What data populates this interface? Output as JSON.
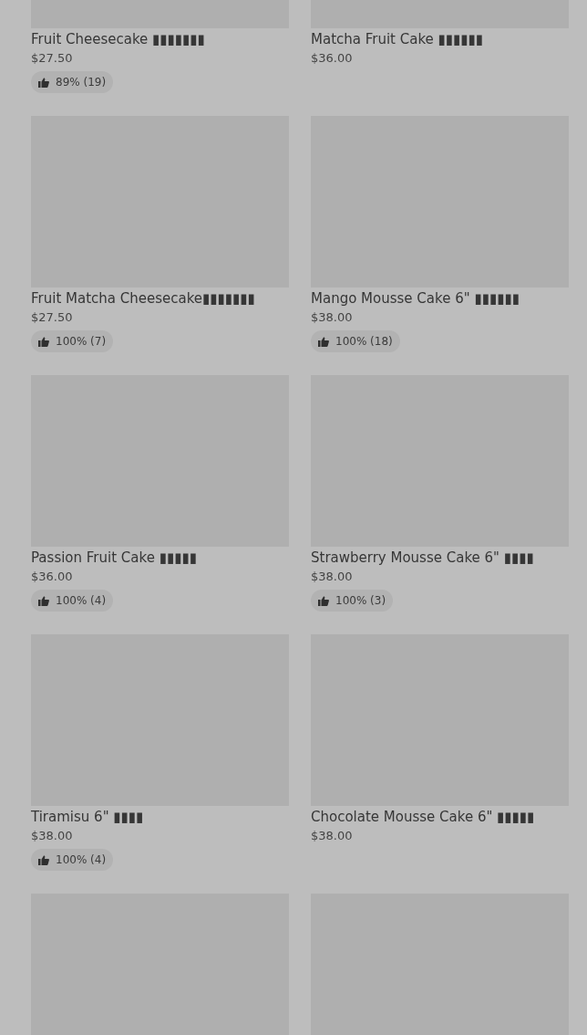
{
  "products": [
    {
      "kind": "product",
      "name": "Fruit Cheesecake ▮▮▮▮▮▮▮",
      "price": "$27.50",
      "rating": "89% (19)"
    },
    {
      "kind": "product",
      "name": "Matcha Fruit Cake ▮▮▮▮▮▮",
      "price": "$36.00"
    },
    {
      "kind": "product",
      "name": "Fruit Matcha Cheesecake▮▮▮▮▮▮▮",
      "price": "$27.50",
      "rating": "100% (7)"
    },
    {
      "kind": "product",
      "name": "Mango Mousse Cake 6\" ▮▮▮▮▮▮",
      "price": "$38.00",
      "rating": "100% (18)"
    },
    {
      "kind": "product",
      "name": "Passion Fruit Cake ▮▮▮▮▮",
      "price": "$36.00",
      "rating": "100% (4)"
    },
    {
      "kind": "product",
      "name": "Strawberry Mousse Cake 6\" ▮▮▮▮",
      "price": "$38.00",
      "rating": "100% (3)"
    },
    {
      "kind": "product",
      "name": "Tiramisu 6\"  ▮▮▮▮",
      "price": "$38.00",
      "rating": "100% (4)"
    },
    {
      "kind": "product",
      "name": "Chocolate Mousse Cake 6\" ▮▮▮▮▮",
      "price": "$38.00"
    },
    {
      "kind": "picture"
    },
    {
      "kind": "picture"
    }
  ]
}
